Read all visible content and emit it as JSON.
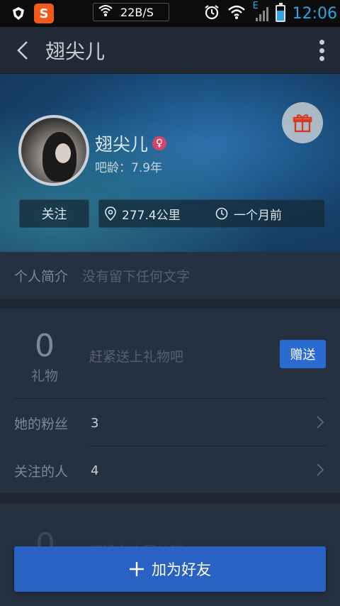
{
  "status_bar": {
    "net_speed": "22B/S",
    "network_type": "E",
    "time": "12:06",
    "icons": [
      "shield-icon",
      "sogou-icon",
      "wifi-icon",
      "alarm-icon",
      "wifi-signal-icon",
      "cell-signal-icon",
      "battery-icon"
    ]
  },
  "app_bar": {
    "title": "翅尖儿"
  },
  "profile": {
    "name": "翅尖儿",
    "gender_symbol": "♀",
    "bar_age": "吧龄：7.9年",
    "follow_label": "关注",
    "distance": "277.4公里",
    "last_active": "一个月前"
  },
  "intro": {
    "label": "个人简介",
    "value": "没有留下任何文字"
  },
  "gifts": {
    "count": "0",
    "label": "礼物",
    "hint": "赶紧送上礼物吧",
    "send_label": "赠送"
  },
  "stats": [
    {
      "label": "她的粉丝",
      "count": "3"
    },
    {
      "label": "关注的人",
      "count": "4"
    }
  ],
  "second_card": {
    "count": "0",
    "hint": "还没有人回帖哦"
  },
  "add_friend": {
    "label": "加为好友"
  },
  "colors": {
    "accent": "#2a62c4",
    "background": "#1f2733",
    "card": "#253040",
    "female": "#d2456d",
    "time": "#2ba6e1"
  }
}
